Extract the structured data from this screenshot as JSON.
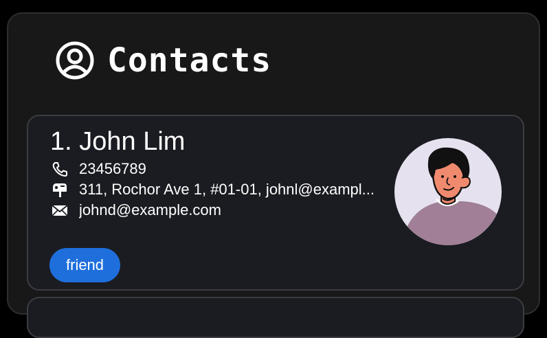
{
  "header": {
    "title": "Contacts",
    "icon": "user-circle-icon"
  },
  "contacts": [
    {
      "index_name": "1. John Lim",
      "phone": "23456789",
      "address": "311, Rochor Ave 1, #01-01, johnl@exampl...",
      "email": "johnd@example.com",
      "tags": [
        "friend"
      ],
      "avatar": "avatar-illustration"
    }
  ],
  "colors": {
    "background": "#000000",
    "panel": "#181818",
    "card": "#1b1c21",
    "tag": "#1e6fdc",
    "text": "#ffffff"
  }
}
